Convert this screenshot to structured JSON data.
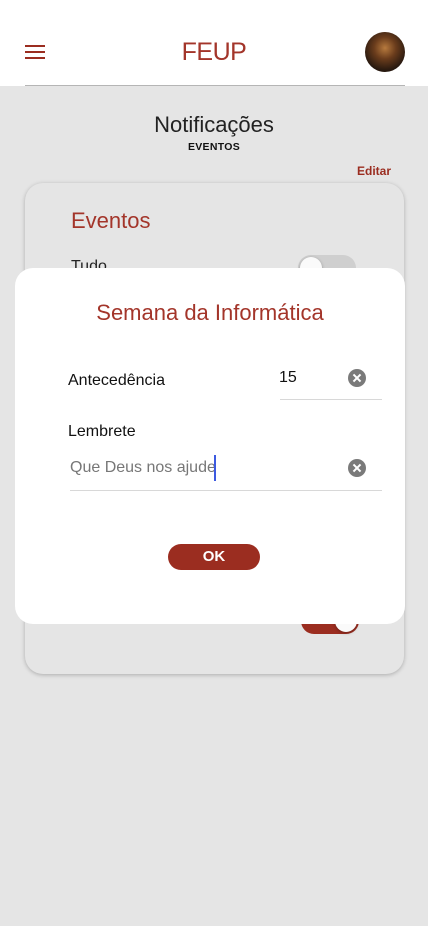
{
  "header": {
    "brand": "FEUP",
    "menu_icon": "menu-icon",
    "avatar_icon": "avatar"
  },
  "page": {
    "title": "Notificações",
    "subtitle": "EVENTOS",
    "edit_label": "Editar"
  },
  "card": {
    "title": "Eventos",
    "row_label": "Tudo",
    "row_toggle_on": false,
    "second_toggle_on": true
  },
  "modal": {
    "title": "Semana da Informática",
    "antecedencia_label": "Antecedência",
    "antecedencia_value": "15",
    "lembrete_label": "Lembrete",
    "lembrete_value": "Que Deus nos ajude",
    "ok_label": "OK"
  },
  "colors": {
    "accent": "#9b2d20",
    "brand_text": "#a3352a",
    "background": "#e5e5e5"
  }
}
